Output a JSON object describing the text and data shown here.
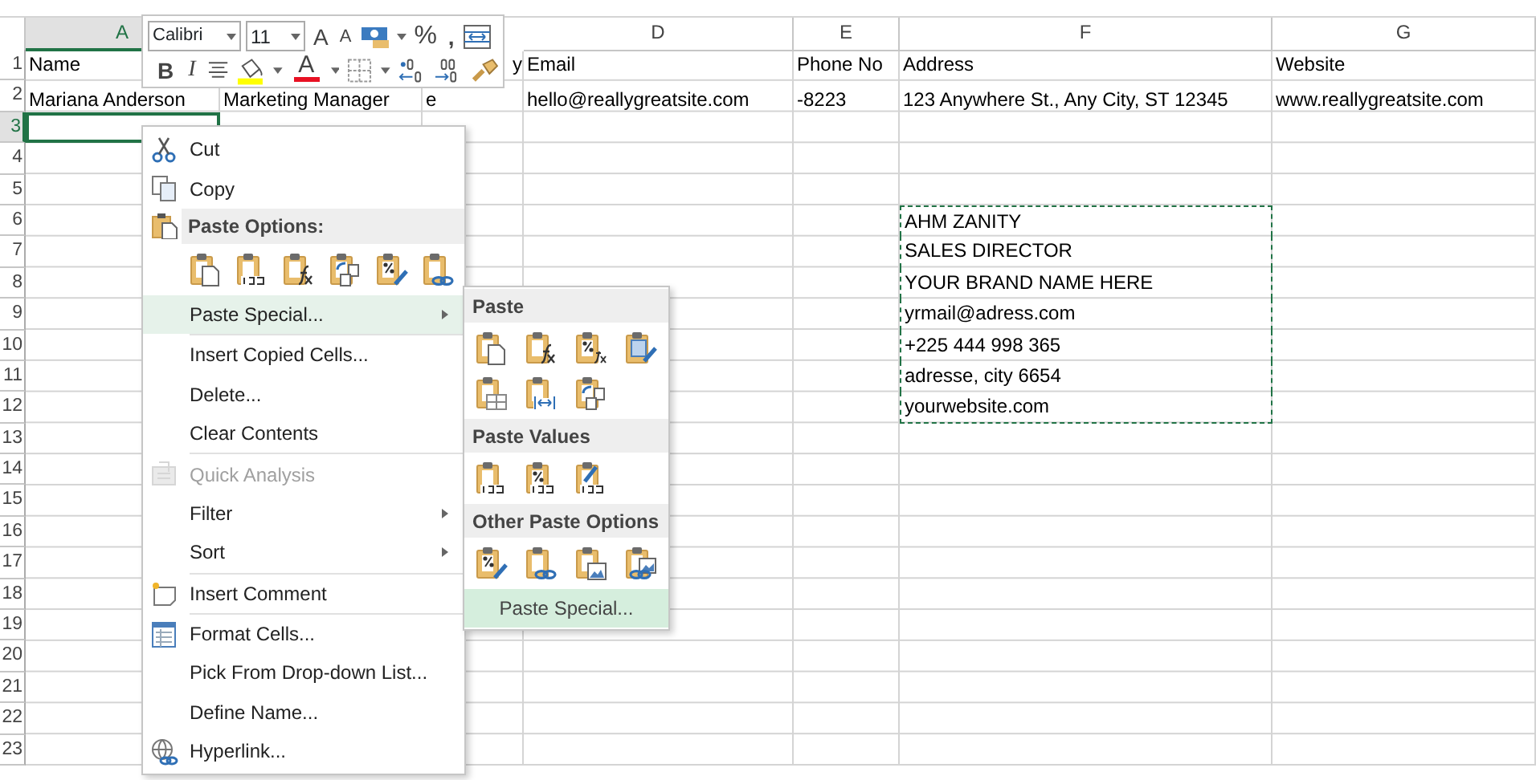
{
  "columns": [
    {
      "selected": true,
      "label": "A"
    },
    {},
    {},
    {
      "selected": false,
      "label": "D"
    },
    {
      "selected": false,
      "label": "E"
    },
    {
      "selected": false,
      "label": "F"
    },
    {
      "selected": false,
      "label": "G"
    }
  ],
  "rows": [
    {
      "number": "1",
      "selected": false,
      "cells": [
        {
          "kind": "text",
          "text": "Name"
        },
        null,
        {
          "kind": "clipped",
          "text": "y"
        },
        {
          "kind": "text",
          "text": "Email"
        },
        {
          "kind": "text",
          "text": "Phone No"
        },
        {
          "kind": "text",
          "text": "Address"
        },
        {
          "kind": "text",
          "text": "Website"
        }
      ]
    },
    {
      "number": "2",
      "selected": false,
      "cells": [
        {
          "kind": "text",
          "text": "Mariana Anderson"
        },
        {
          "kind": "text",
          "text": "Marketing Manager"
        },
        {
          "kind": "text",
          "text": "e"
        },
        {
          "kind": "text",
          "text": "hello@reallygreatsite.com"
        },
        {
          "kind": "number",
          "text": "-8223"
        },
        {
          "kind": "text",
          "text": "123 Anywhere St., Any City, ST 12345"
        },
        {
          "kind": "text",
          "text": "www.reallygreatsite.com"
        }
      ]
    },
    {
      "number": "3",
      "selected": true,
      "cells": [
        {
          "kind": "text",
          "selected": true
        },
        null,
        null,
        null,
        null,
        null,
        null
      ]
    },
    {
      "number": "4",
      "selected": false
    },
    {
      "number": "5",
      "selected": false
    },
    {
      "number": "6",
      "selected": false,
      "cells": [
        null,
        null,
        null,
        null,
        null,
        {
          "kind": "text",
          "text": "AHM ZANITY",
          "copied": true
        },
        null
      ]
    },
    {
      "number": "7",
      "selected": false,
      "cells": [
        null,
        null,
        null,
        null,
        null,
        {
          "kind": "text",
          "text": "SALES DIRECTOR",
          "copied": true
        },
        null
      ]
    },
    {
      "number": "8",
      "selected": false,
      "cells": [
        null,
        null,
        null,
        null,
        null,
        {
          "kind": "text",
          "text": "YOUR BRAND NAME HERE",
          "copied": true
        },
        null
      ]
    },
    {
      "number": "9",
      "selected": false,
      "cells": [
        null,
        null,
        null,
        null,
        null,
        {
          "kind": "text",
          "text": "yrmail@adress.com",
          "copied": true
        },
        null
      ]
    },
    {
      "number": "10",
      "selected": false,
      "cells": [
        null,
        null,
        null,
        null,
        null,
        {
          "kind": "text",
          "text": "+225 444 998 365",
          "copied": true
        },
        null
      ]
    },
    {
      "number": "11",
      "selected": false,
      "cells": [
        null,
        null,
        null,
        null,
        null,
        {
          "kind": "text",
          "text": "adresse, city 6654",
          "copied": true
        },
        null
      ]
    },
    {
      "number": "12",
      "selected": false,
      "cells": [
        null,
        null,
        null,
        null,
        null,
        {
          "kind": "text",
          "text": "yourwebsite.com",
          "copied": true
        },
        null
      ]
    },
    {
      "number": "13",
      "selected": false
    },
    {
      "number": "14",
      "selected": false
    },
    {
      "number": "15",
      "selected": false
    },
    {
      "number": "16",
      "selected": false
    },
    {
      "number": "17",
      "selected": false
    },
    {
      "number": "18",
      "selected": false
    },
    {
      "number": "19",
      "selected": false
    },
    {
      "number": "20",
      "selected": false
    },
    {
      "number": "21",
      "selected": false
    },
    {
      "number": "22",
      "selected": false
    },
    {
      "number": "23",
      "selected": false
    }
  ],
  "mini_toolbar": {
    "font": "Calibri",
    "size": "11",
    "grow": "A",
    "shrink": "A",
    "percent": "%",
    "comma": ",",
    "bold": "B",
    "italic": "I",
    "font_color": "A"
  },
  "context_menu": [
    {
      "kind": "item",
      "label": "Cut",
      "selected": false,
      "disabled": false,
      "submenu": false
    },
    {
      "kind": "item",
      "label": "Copy",
      "selected": false,
      "disabled": false,
      "submenu": false
    },
    {
      "kind": "header",
      "label": "Paste Options:"
    },
    {
      "kind": "icons"
    },
    {
      "kind": "item",
      "label": "Paste Special...",
      "selected": true,
      "disabled": false,
      "submenu": true
    },
    {
      "kind": "separator"
    },
    {
      "kind": "item",
      "label": "Insert Copied Cells...",
      "selected": false,
      "disabled": false,
      "submenu": false
    },
    {
      "kind": "item",
      "label": "Delete...",
      "selected": false,
      "disabled": false,
      "submenu": false
    },
    {
      "kind": "item",
      "label": "Clear Contents",
      "selected": false,
      "disabled": false,
      "submenu": false
    },
    {
      "kind": "separator"
    },
    {
      "kind": "item",
      "label": "Quick Analysis",
      "selected": false,
      "disabled": true,
      "submenu": false
    },
    {
      "kind": "item",
      "label": "Filter",
      "selected": false,
      "disabled": false,
      "submenu": true
    },
    {
      "kind": "item",
      "label": "Sort",
      "selected": false,
      "disabled": false,
      "submenu": true
    },
    {
      "kind": "separator"
    },
    {
      "kind": "item",
      "label": "Insert Comment",
      "selected": false,
      "disabled": false,
      "submenu": false
    },
    {
      "kind": "separator"
    },
    {
      "kind": "item",
      "label": "Format Cells...",
      "selected": false,
      "disabled": false,
      "submenu": false
    },
    {
      "kind": "item",
      "label": "Pick From Drop-down List...",
      "selected": false,
      "disabled": false,
      "submenu": false
    },
    {
      "kind": "item",
      "label": "Define Name...",
      "selected": false,
      "disabled": false,
      "submenu": false
    },
    {
      "kind": "item",
      "label": "Hyperlink...",
      "selected": false,
      "disabled": false,
      "submenu": false
    }
  ],
  "paste_submenu": {
    "sections": [
      {
        "title": "Paste"
      },
      {
        "title": "Paste Values"
      },
      {
        "title": "Other Paste Options"
      }
    ],
    "footer": {
      "label": "Paste Special...",
      "selected": true
    }
  }
}
